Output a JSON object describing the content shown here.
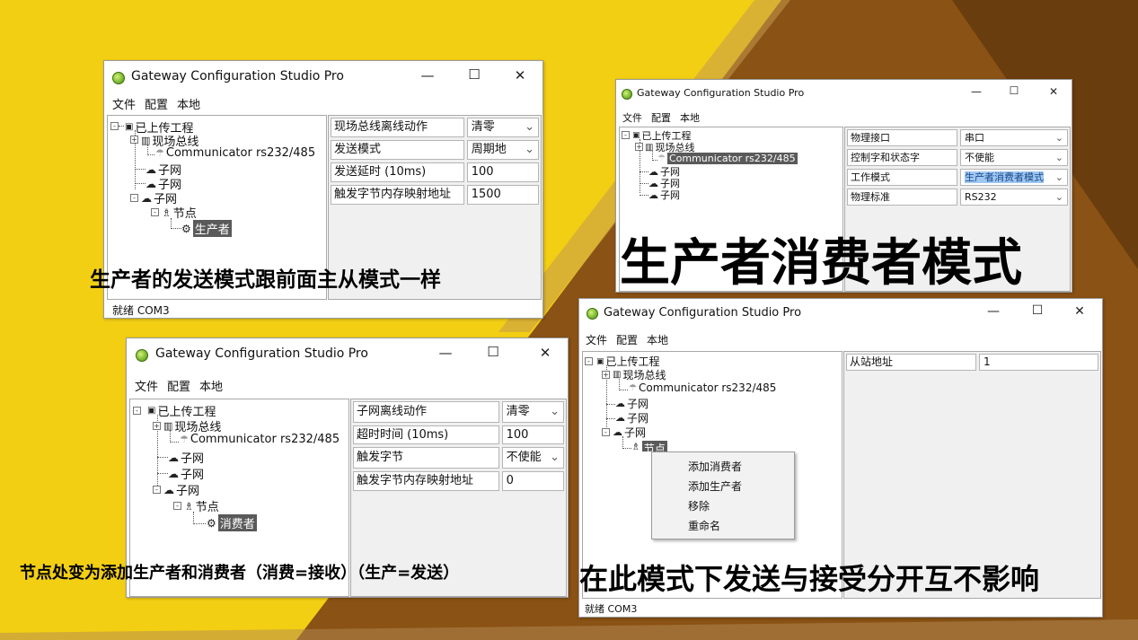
{
  "colors": {
    "yellow": "#f3cf14",
    "brown": "#8a5214",
    "dark_brown": "#6a3d0e",
    "stripe": "#c49a4c",
    "selection": "#5a5a5a",
    "highlight": "#9fc7f1"
  },
  "app_title": "Gateway Configuration Studio Pro",
  "window_controls": {
    "minimize": "—",
    "maximize": "☐",
    "close": "✕"
  },
  "menu": {
    "file": "文件",
    "config": "配置",
    "local": "本地"
  },
  "status_text": "就绪 COM3",
  "tree": {
    "root": "已上传工程",
    "fieldbus": "现场总线",
    "communicator": "Communicator rs232/485",
    "subnet": "子网",
    "node": "节点",
    "producer": "生产者",
    "consumer": "消费者"
  },
  "icons": {
    "tree_root": "document-icon",
    "fieldbus": "bus-icon",
    "communicator": "antenna-icon",
    "subnet": "cloud-icon",
    "node": "network-icon",
    "producer": "gear-icon",
    "consumer": "gear-icon"
  },
  "window1": {
    "properties": [
      {
        "name": "现场总线离线动作",
        "value": "清零",
        "dropdown": true
      },
      {
        "name": "发送模式",
        "value": "周期地",
        "dropdown": true
      },
      {
        "name": "发送延时 (10ms)",
        "value": "100",
        "dropdown": false
      },
      {
        "name": "触发字节内存映射地址",
        "value": "1500",
        "dropdown": false
      }
    ],
    "caption": "生产者的发送模式跟前面主从模式一样"
  },
  "window2": {
    "properties": [
      {
        "name": "物理接口",
        "value": "串口",
        "dropdown": true
      },
      {
        "name": "控制字和状态字",
        "value": "不使能",
        "dropdown": true
      },
      {
        "name": "工作模式",
        "value": "生产者消费者模式",
        "dropdown": true
      },
      {
        "name": "物理标准",
        "value": "RS232",
        "dropdown": true
      }
    ],
    "caption": "生产者消费者模式"
  },
  "window3": {
    "properties": [
      {
        "name": "子网离线动作",
        "value": "清零",
        "dropdown": true
      },
      {
        "name": "超时时间 (10ms)",
        "value": "100",
        "dropdown": false
      },
      {
        "name": "触发字节",
        "value": "不使能",
        "dropdown": true
      },
      {
        "name": "触发字节内存映射地址",
        "value": "0",
        "dropdown": false
      }
    ],
    "caption": "节点处变为添加生产者和消费者（消费=接收）（生产=发送）"
  },
  "window4": {
    "properties": [
      {
        "name": "从站地址",
        "value": "1",
        "dropdown": false
      }
    ],
    "node_label_partial": "节点",
    "context_menu": [
      "添加消费者",
      "添加生产者",
      "移除",
      "重命名"
    ],
    "caption": "在此模式下发送与接受分开互不影响"
  }
}
